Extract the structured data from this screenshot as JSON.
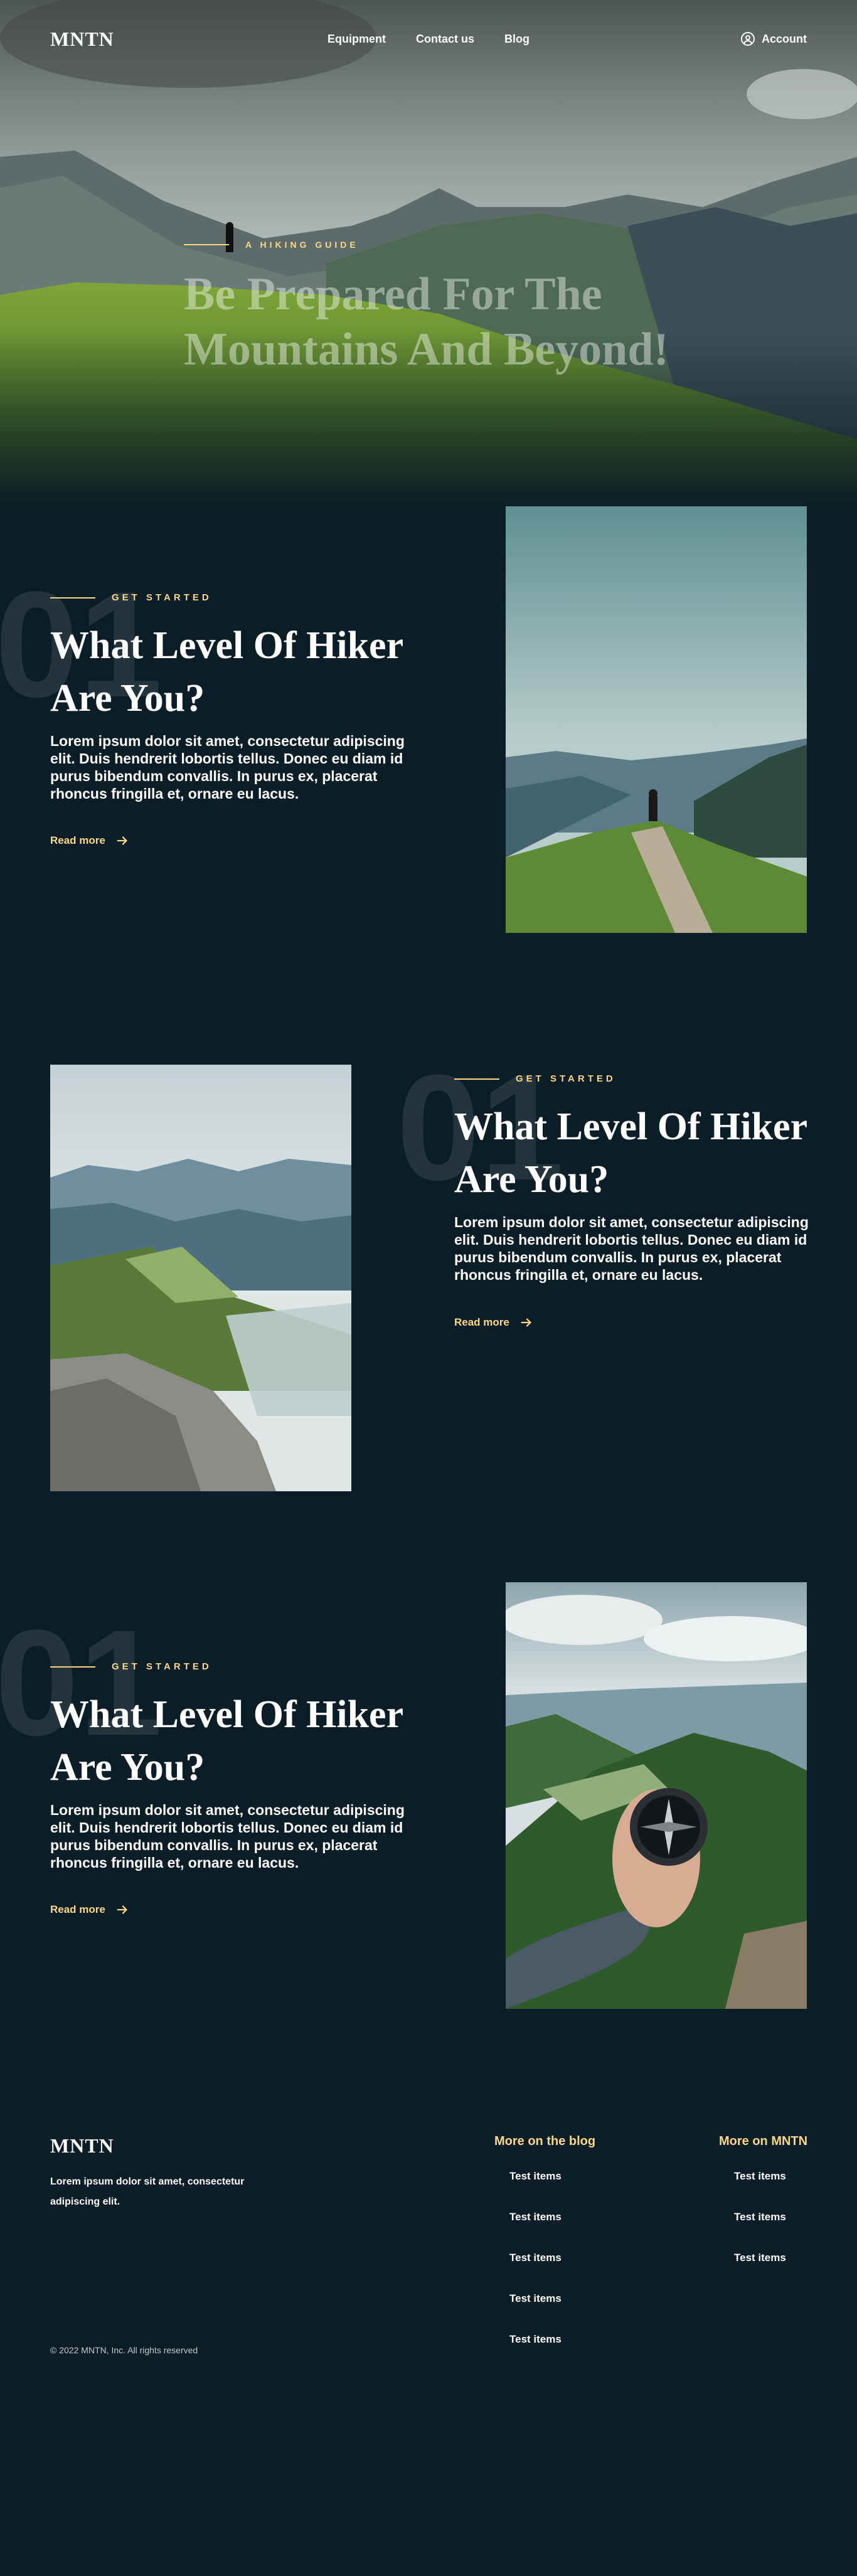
{
  "brand": {
    "logo": "MNTN"
  },
  "nav": {
    "items": [
      "Equipment",
      "Contact us",
      "Blog"
    ],
    "account_label": "Account"
  },
  "hero": {
    "eyebrow": "A HIKING GUIDE",
    "title": "Be Prepared For The Mountains And Beyond!"
  },
  "features": [
    {
      "number": "01",
      "eyebrow": "GET STARTED",
      "title": "What Level Of Hiker Are You?",
      "body": "Lorem ipsum dolor sit amet, consectetur adipiscing elit. Duis hendrerit lobortis tellus. Donec eu diam id purus bibendum convallis. In purus ex, placerat rhoncus fringilla et, ornare eu lacus.",
      "link": "Read more"
    },
    {
      "number": "01",
      "eyebrow": "GET STARTED",
      "title": "What Level Of Hiker Are You?",
      "body": "Lorem ipsum dolor sit amet, consectetur adipiscing elit. Duis hendrerit lobortis tellus. Donec eu diam id purus bibendum convallis. In purus ex, placerat rhoncus fringilla et, ornare eu lacus.",
      "link": "Read more"
    },
    {
      "number": "01",
      "eyebrow": "GET STARTED",
      "title": "What Level Of Hiker Are You?",
      "body": "Lorem ipsum dolor sit amet, consectetur adipiscing elit. Duis hendrerit lobortis tellus. Donec eu diam id purus bibendum convallis. In purus ex, placerat rhoncus fringilla et, ornare eu lacus.",
      "link": "Read more"
    }
  ],
  "footer": {
    "logo": "MNTN",
    "description": "Lorem ipsum dolor sit amet, consectetur adipiscing elit.",
    "copyright": "© 2022 MNTN, Inc. All rights reserved",
    "blog_heading": "More on the blog",
    "blog_items": [
      "Test items",
      "Test items",
      "Test items",
      "Test items",
      "Test items"
    ],
    "mntn_heading": "More on MNTN",
    "mntn_items": [
      "Test items",
      "Test items",
      "Test items"
    ]
  },
  "colors": {
    "background": "#0b1d26",
    "accent": "#fbd784",
    "text": "#ffffff"
  },
  "icons": [
    "user-circle-icon",
    "arrow-right-icon"
  ]
}
